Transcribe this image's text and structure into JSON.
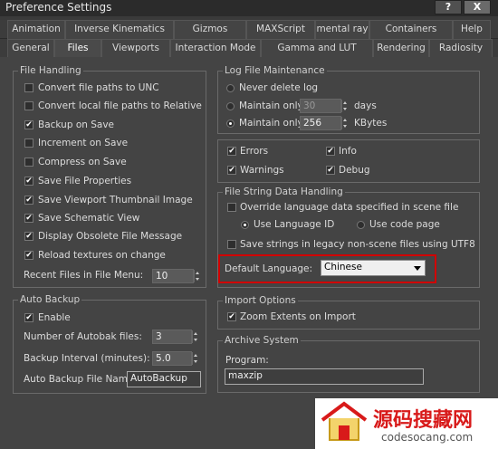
{
  "window": {
    "title": "Preference Settings",
    "help_button": "?",
    "close_button": "X"
  },
  "tabs_row1": [
    "Animation",
    "Inverse Kinematics",
    "Gizmos",
    "MAXScript",
    "mental ray",
    "Containers",
    "Help"
  ],
  "tabs_row2": [
    "General",
    "Files",
    "Viewports",
    "Interaction Mode",
    "Gamma and LUT",
    "Rendering",
    "Radiosity"
  ],
  "file_handling": {
    "title": "File Handling",
    "options": [
      {
        "label": "Convert file paths to UNC",
        "checked": false
      },
      {
        "label": "Convert local file paths to Relative",
        "checked": false
      },
      {
        "label": "Backup on Save",
        "checked": true
      },
      {
        "label": "Increment on Save",
        "checked": false
      },
      {
        "label": "Compress on Save",
        "checked": false
      },
      {
        "label": "Save File Properties",
        "checked": true
      },
      {
        "label": "Save Viewport Thumbnail Image",
        "checked": true
      },
      {
        "label": "Save Schematic View",
        "checked": true
      },
      {
        "label": "Display Obsolete File Message",
        "checked": true
      },
      {
        "label": "Reload textures on change",
        "checked": true
      }
    ],
    "recent_files_label": "Recent Files in File Menu:",
    "recent_files_value": "10"
  },
  "auto_backup": {
    "title": "Auto Backup",
    "enable_label": "Enable",
    "enable_checked": true,
    "num_files_label": "Number of Autobak files:",
    "num_files_value": "3",
    "interval_label": "Backup Interval (minutes):",
    "interval_value": "5.0",
    "filename_label": "Auto Backup File Name:",
    "filename_value": "AutoBackup"
  },
  "log_maintenance": {
    "title": "Log File Maintenance",
    "never_delete": "Never delete log",
    "maintain_only": "Maintain only",
    "days_value": "30",
    "days_label": "days",
    "kb_value": "256",
    "kb_label": "KBytes",
    "selected": "kbytes"
  },
  "log_types": {
    "errors": "Errors",
    "info": "Info",
    "warnings": "Warnings",
    "debug": "Debug"
  },
  "file_string": {
    "title": "File String Data Handling",
    "override_label": "Override language data specified in scene file",
    "use_language_id": "Use Language ID",
    "use_code_page": "Use code page",
    "legacy_label": "Save strings in legacy non-scene files using UTF8",
    "default_language_label": "Default Language:",
    "default_language_value": "Chinese"
  },
  "import_options": {
    "title": "Import Options",
    "zoom_label": "Zoom Extents on Import"
  },
  "archive_system": {
    "title": "Archive System",
    "program_label": "Program:",
    "program_value": "maxzip"
  },
  "watermark": {
    "brand": "源码搜藏网",
    "url": "codesocang.com"
  },
  "colors": {
    "highlight": "#d10000",
    "panel": "#444444",
    "watermark_red": "#d81a1a"
  }
}
